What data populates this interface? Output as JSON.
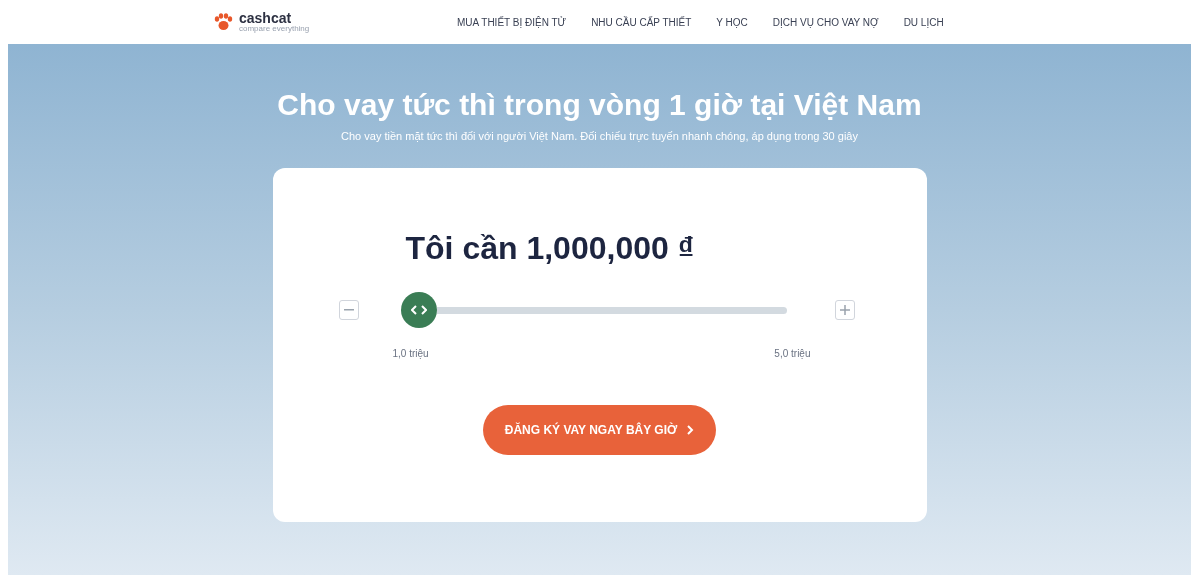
{
  "header": {
    "logo": {
      "name": "cashcat",
      "tagline": "compare everything"
    },
    "nav": [
      {
        "label": "MUA THIẾT BỊ ĐIỆN TỬ"
      },
      {
        "label": "NHU CẦU CẤP THIẾT"
      },
      {
        "label": "Y HỌC"
      },
      {
        "label": "DỊCH VỤ CHO VAY NỢ"
      },
      {
        "label": "DU LỊCH"
      }
    ]
  },
  "hero": {
    "title": "Cho vay tức thì trong vòng 1 giờ tại Việt Nam",
    "subtitle": "Cho vay tiền mặt tức thì đối với người Việt Nam. Đối chiếu trực tuyến nhanh chóng, áp dụng trong 30 giây"
  },
  "calculator": {
    "heading": "Tôi cần 1,000,000 ₫",
    "slider": {
      "level": 0,
      "min_label": "1,0 triệu",
      "max_label": "5,0 triệu"
    },
    "button": "ĐĂNG KÝ VAY NGAY BÂY GIỜ"
  }
}
